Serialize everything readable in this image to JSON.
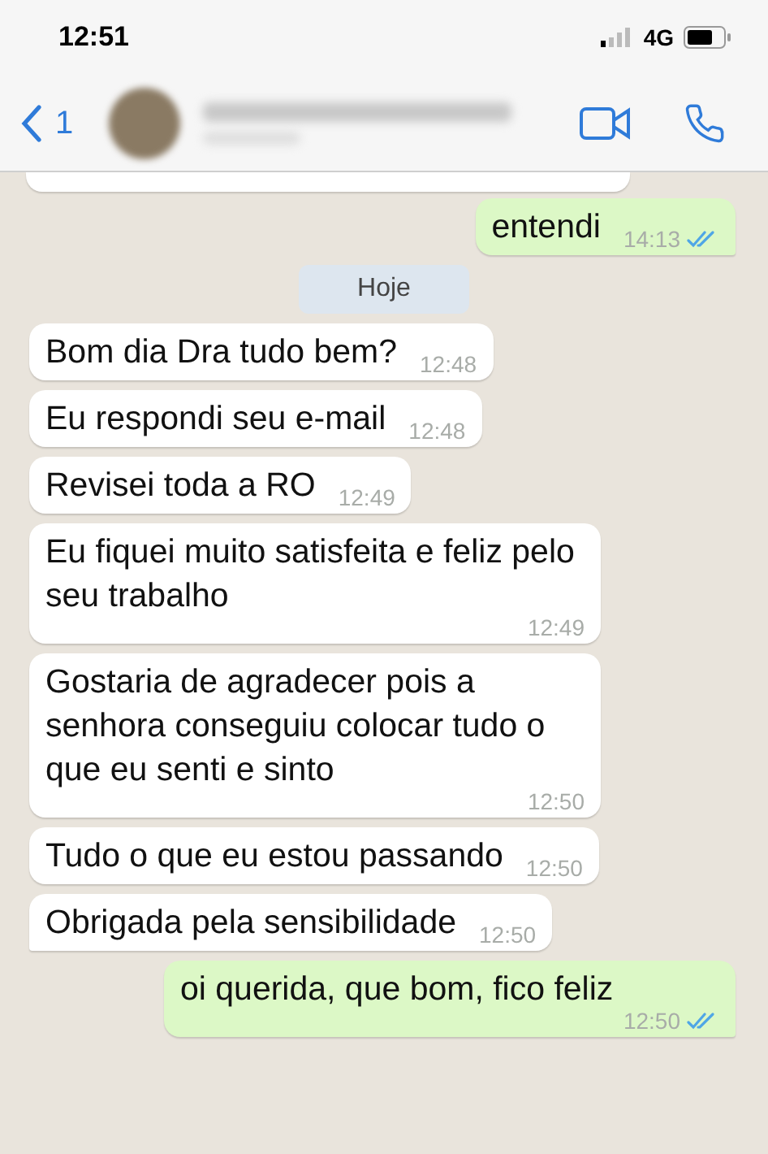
{
  "status_bar": {
    "time": "12:51",
    "network": "4G"
  },
  "header": {
    "back_count": "1"
  },
  "day_label": "Hoje",
  "messages": [
    {
      "kind": "outgoing",
      "text": "entendi",
      "time": "14:13",
      "read": true
    },
    {
      "kind": "day"
    },
    {
      "kind": "incoming",
      "text": "Bom dia Dra tudo bem?",
      "time": "12:48",
      "tail": false
    },
    {
      "kind": "incoming",
      "text": "Eu respondi seu e-mail",
      "time": "12:48",
      "tail": false
    },
    {
      "kind": "incoming",
      "text": "Revisei toda a RO",
      "time": "12:49",
      "tail": false
    },
    {
      "kind": "incoming",
      "text": "Eu fiquei muito satisfeita e feliz pelo seu trabalho",
      "time": "12:49",
      "tail": false
    },
    {
      "kind": "incoming",
      "text": "Gostaria de agradecer pois a senhora conseguiu colocar tudo o que eu senti e sinto",
      "time": "12:50",
      "tail": false
    },
    {
      "kind": "incoming",
      "text": "Tudo o que eu estou passando",
      "time": "12:50",
      "tail": false
    },
    {
      "kind": "incoming",
      "text": "Obrigada pela sensibilidade",
      "time": "12:50",
      "tail": true
    },
    {
      "kind": "outgoing",
      "text": "oi querida, que bom, fico feliz",
      "time": "12:50",
      "read": true
    }
  ]
}
